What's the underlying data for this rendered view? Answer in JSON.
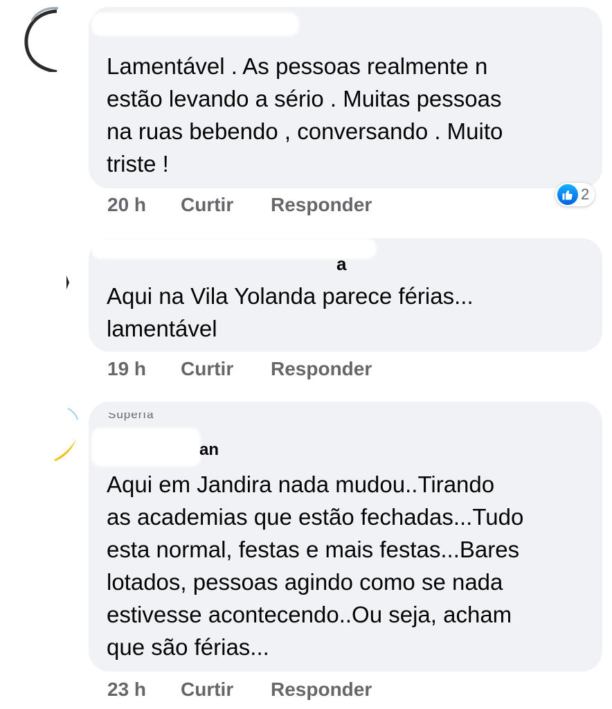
{
  "comments": [
    {
      "name_visible_fragment": "",
      "text_lines": [
        "Lamentável . As pessoas realmente n",
        "estão levando a sério . Muitas pessoas",
        "na ruas bebendo , conversando . Muito",
        "triste !"
      ],
      "time": "20 h",
      "like_label": "Curtir",
      "reply_label": "Responder",
      "reaction": {
        "icon": "thumbs-up-icon",
        "count": "2",
        "color": "#1877f2"
      }
    },
    {
      "name_visible_fragment": "a",
      "text_lines": [
        "Aqui na Vila Yolanda parece férias...",
        "lamentável"
      ],
      "time": "19 h",
      "like_label": "Curtir",
      "reply_label": "Responder"
    },
    {
      "badge_visible_fragment": "Superfã",
      "name_visible_fragment": "an",
      "text_lines": [
        "Aqui em Jandira nada mudou..Tirando",
        "as academias que estão fechadas...Tudo",
        "esta normal, festas e mais festas...Bares",
        "lotados, pessoas agindo como se nada",
        "estivesse acontecendo..Ou seja, acham",
        "que são férias..."
      ],
      "time": "23 h",
      "like_label": "Curtir",
      "reply_label": "Responder"
    }
  ],
  "colors": {
    "bubble": "#f0f2f5",
    "text": "#050505",
    "meta": "#65676b",
    "like_blue": "#1877f2"
  }
}
